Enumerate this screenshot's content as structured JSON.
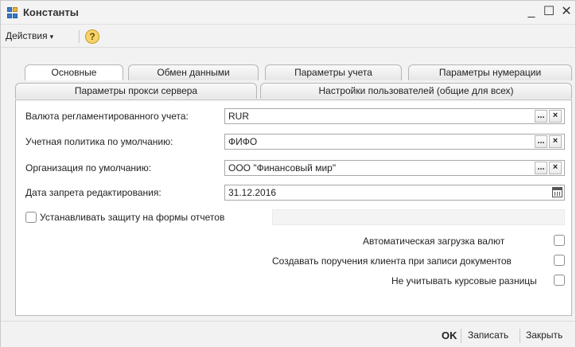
{
  "window": {
    "title": "Константы",
    "minimize": "_",
    "maximize": "☐",
    "close": "✕"
  },
  "toolbar": {
    "actions_label": "Действия",
    "actions_caret": "▾",
    "help_label": "?"
  },
  "tabs_row1": [
    "Основные",
    "Обмен данными",
    "Параметры учета",
    "Параметры нумерации"
  ],
  "tabs_row2": [
    "Параметры прокси сервера",
    "Настройки пользователей (общие для всех)"
  ],
  "active_tab": "Основные",
  "form": {
    "currency_label": "Валюта регламентированного учета:",
    "currency_value": "RUR",
    "policy_label": "Учетная политика по умолчанию:",
    "policy_value": "ФИФО",
    "org_label": "Организация по умолчанию:",
    "org_value": "ООО \"Финансовый мир\"",
    "edit_lock_label": "Дата запрета редактирования:",
    "edit_lock_value": "31.12.2016",
    "select_btn": "...",
    "clear_btn": "×",
    "protect_reports_label": "Устанавливать защиту на формы отчетов",
    "protect_reports_checked": false,
    "auto_currency_label": "Автоматическая загрузка валют",
    "auto_currency_checked": false,
    "client_orders_label": "Создавать поручения клиента при записи документов",
    "client_orders_checked": false,
    "ignore_fx_label": "Не учитывать курсовые разницы",
    "ignore_fx_checked": false
  },
  "footer": {
    "ok_label": "OK",
    "save_label": "Записать",
    "close_label": "Закрыть"
  }
}
